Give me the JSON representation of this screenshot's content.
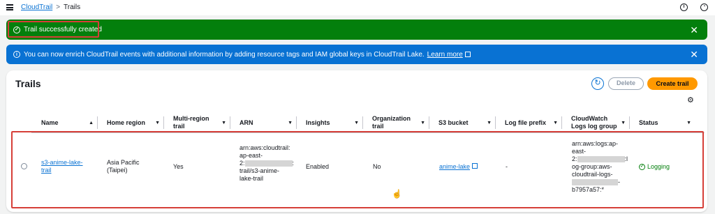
{
  "breadcrumb": {
    "root": "CloudTrail",
    "separator": ">",
    "current": "Trails"
  },
  "flash_success": {
    "message": "Trail successfully created",
    "close": "✕"
  },
  "flash_info": {
    "message": "You can now enrich CloudTrail events with additional information by adding resource tags and IAM global keys in CloudTrail Lake.",
    "link": "Learn more",
    "close": "✕"
  },
  "panel": {
    "title": "Trails",
    "delete_label": "Delete",
    "create_label": "Create trail",
    "refresh_glyph": "↻",
    "settings_glyph": "⚙"
  },
  "table": {
    "columns": [
      "Name",
      "Home region",
      "Multi-region trail",
      "ARN",
      "Insights",
      "Organization trail",
      "S3 bucket",
      "Log file prefix",
      "CloudWatch Logs log group",
      "Status"
    ],
    "sort_indicators": [
      "▲",
      "▼"
    ],
    "row": {
      "name": "s3-anime-lake-trail",
      "home_region": "Asia Pacific (Taipei)",
      "multi_region": "Yes",
      "arn_parts": [
        "arn:aws:cloudtrail:",
        "ap-east-",
        "2:",
        ":",
        "trail/s3-anime-",
        "lake-trail"
      ],
      "insights": "Enabled",
      "organization_trail": "No",
      "s3_bucket": "anime-lake",
      "log_file_prefix": "-",
      "log_group_parts": [
        "arn:aws:logs:ap-",
        "east-",
        "2:",
        ":l",
        "og-group:aws-",
        "cloudtrail-logs-",
        "-",
        "b7957a57:*"
      ],
      "status": "Logging"
    }
  },
  "colors": {
    "success": "#037f0c",
    "info": "#0972d3",
    "primary_button": "#ff9900",
    "highlight": "#d63f38"
  }
}
